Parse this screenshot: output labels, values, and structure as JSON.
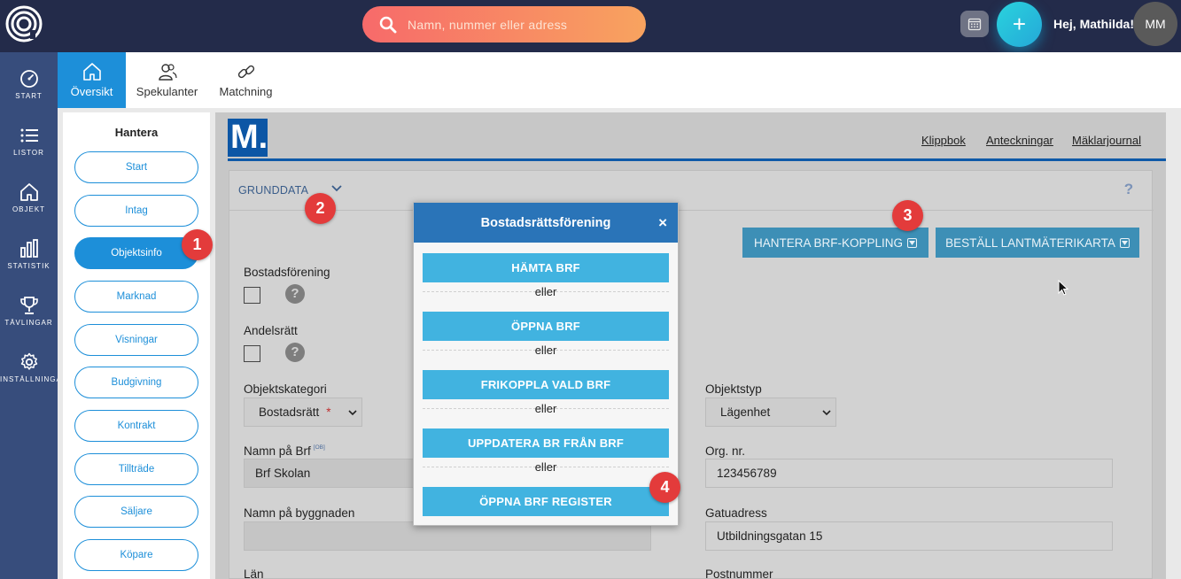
{
  "search": {
    "placeholder": "Namn, nummer eller adress"
  },
  "header": {
    "greeting": "Hej, Mathilda!",
    "avatar_initials": "MM",
    "plus_label": "+"
  },
  "leftnav": {
    "items": [
      {
        "label": "START",
        "icon": "speedometer-icon"
      },
      {
        "label": "LISTOR",
        "icon": "list-icon"
      },
      {
        "label": "OBJEKT",
        "icon": "home-icon"
      },
      {
        "label": "STATISTIK",
        "icon": "bar-chart-icon"
      },
      {
        "label": "TÄVLINGAR",
        "icon": "trophy-icon"
      },
      {
        "label": "INSTÄLLNINGAR",
        "icon": "gear-icon"
      }
    ]
  },
  "tabs": [
    {
      "label": "Översikt",
      "icon": "home-icon",
      "active": true
    },
    {
      "label": "Spekulanter",
      "icon": "users-icon",
      "active": false
    },
    {
      "label": "Matchning",
      "icon": "link-icon",
      "active": false
    }
  ],
  "hantera": {
    "title": "Hantera",
    "items": [
      "Start",
      "Intag",
      "Objektsinfo",
      "Marknad",
      "Visningar",
      "Budgivning",
      "Kontrakt",
      "Tillträde",
      "Säljare",
      "Köpare"
    ],
    "active_index": 2
  },
  "content": {
    "logo_text": "M.",
    "links": [
      "Klippbok",
      "Anteckningar",
      "Mäklarjournal"
    ],
    "section_title": "GRUNDDATA",
    "help": "?",
    "buttons": [
      "HANTERA BRF-KOPPLING",
      "BESTÄLL LANTMÄTERIKARTA"
    ]
  },
  "form": {
    "bostadsforening_label": "Bostadsförening",
    "andelsratt_label": "Andelsrätt",
    "objektskategori_label": "Objektskategori",
    "objektskategori_value": "Bostadsrätt",
    "required_mark": "*",
    "objektstyp_label": "Objektstyp",
    "objektstyp_value": "Lägenhet",
    "brf_name_label": "Namn på Brf",
    "brf_tag": "[OB]",
    "brf_name_value": "Brf Skolan",
    "orgnr_label": "Org. nr.",
    "orgnr_value": "123456789",
    "byggnad_label": "Namn på byggnaden",
    "byggnad_value": "",
    "gatuadress_label": "Gatuadress",
    "gatuadress_value": "Utbildningsgatan 15",
    "lan_label": "Län",
    "postnummer_label": "Postnummer"
  },
  "modal": {
    "title": "Bostadsrättsförening",
    "close": "×",
    "buttons": [
      "HÄMTA BRF",
      "ÖPPNA BRF",
      "FRIKOPPLA VALD BRF",
      "UPPDATERA BR FRÅN BRF",
      "ÖPPNA BRF REGISTER"
    ],
    "separator": "eller"
  },
  "badges": [
    "1",
    "2",
    "3",
    "4"
  ],
  "colors": {
    "topbar": "#232b4a",
    "leftnav": "#374d7c",
    "accent": "#1d8fd9",
    "modal_header": "#2a74b8",
    "modal_button": "#41b3e0",
    "badge": "#e33b3b"
  }
}
